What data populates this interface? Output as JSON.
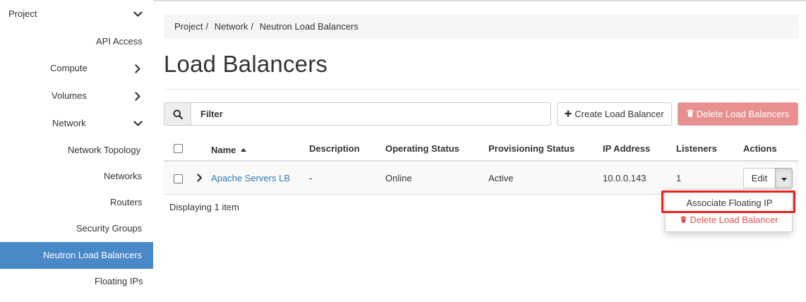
{
  "sidebar": {
    "project": "Project",
    "api_access": "API Access",
    "compute": "Compute",
    "volumes": "Volumes",
    "network": "Network",
    "network_topology": "Network Topology",
    "networks": "Networks",
    "routers": "Routers",
    "security_groups": "Security Groups",
    "neutron_load_balancers": "Neutron Load Balancers",
    "floating_ips": "Floating IPs",
    "active_color": "#4a89c8"
  },
  "breadcrumb": {
    "items": [
      "Project",
      "Network",
      "Neutron Load Balancers"
    ],
    "separator": "/"
  },
  "page": {
    "title": "Load Balancers"
  },
  "toolbar": {
    "filter_placeholder": "Filter",
    "create_label": "Create Load Balancer",
    "delete_label": "Delete Load Balancers",
    "delete_color": "#e7908f"
  },
  "table": {
    "columns": {
      "name": "Name",
      "description": "Description",
      "operating_status": "Operating Status",
      "provisioning_status": "Provisioning Status",
      "ip_address": "IP Address",
      "listeners": "Listeners",
      "actions": "Actions"
    },
    "sort": {
      "column": "Name",
      "direction": "ascending"
    },
    "rows": [
      {
        "name": "Apache Servers LB",
        "description": "-",
        "operating_status": "Online",
        "provisioning_status": "Active",
        "ip_address": "10.0.0.143",
        "listeners": "1",
        "action_label": "Edit"
      }
    ],
    "footer": "Displaying 1 item"
  },
  "dropdown": {
    "associate": "Associate Floating IP",
    "delete": "Delete Load Balancer",
    "highlight_color": "#e8231c"
  },
  "icons": {
    "search": "search-icon",
    "plus": "plus-icon",
    "trash": "trash-icon",
    "chevron_down": "chevron-down-icon",
    "chevron_right": "chevron-right-icon",
    "sort_up": "sort-up-icon",
    "caret_down": "caret-down-icon"
  }
}
